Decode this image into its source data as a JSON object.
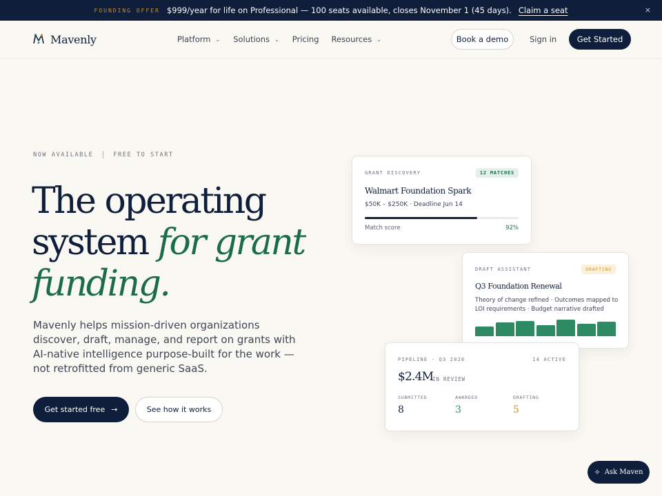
{
  "announcement": {
    "tag": "FOUNDING OFFER",
    "message": "$999/year for life on Professional — 100 seats available, closes November 1 (45 days).",
    "cta": "Claim a seat",
    "close": "×"
  },
  "nav": {
    "brand": "Mavenly",
    "menu": [
      {
        "label": "Platform",
        "has_dropdown": true
      },
      {
        "label": "Solutions",
        "has_dropdown": true
      },
      {
        "label": "Pricing",
        "has_dropdown": false
      },
      {
        "label": "Resources",
        "has_dropdown": true
      }
    ],
    "book_demo": "Book a demo",
    "sign_in": "Sign in",
    "get_started": "Get Started"
  },
  "hero": {
    "eyebrow_left": "NOW AVAILABLE",
    "eyebrow_right": "FREE TO START",
    "headline_line1": "The operating",
    "headline_line2_plain": "system ",
    "headline_line2_accent": "for grant",
    "headline_line3_accent": "funding.",
    "subheadline": "Mavenly helps mission-driven organizations discover, draft, manage, and report on grants with AI-native intelligence purpose-built for the work — not retrofitted from generic SaaS.",
    "primary_cta": "Get started free",
    "primary_cta_icon": "arrow-right-icon",
    "secondary_cta": "See how it works"
  },
  "cards": {
    "discovery": {
      "label": "GRANT DISCOVERY",
      "badge": "12 MATCHES",
      "title": "Walmart Foundation Spark",
      "meta": "$50K – $250K · Deadline Jun 14",
      "match_label": "Match score",
      "match_value": "92%",
      "match_fraction": 0.73
    },
    "draft": {
      "label": "DRAFT ASSISTANT",
      "badge": "DRAFTING",
      "title": "Q3 Foundation Renewal",
      "description": "Theory of change refined · Outcomes mapped to LOI requirements · Budget narrative drafted",
      "bar_levels": [
        0.55,
        0.8,
        0.88,
        0.65,
        0.95,
        0.72,
        0.85
      ]
    },
    "pipeline": {
      "label": "PIPELINE · Q3 2026",
      "active": "14 ACTIVE",
      "amount": "$2.4M",
      "amount_label": "IN REVIEW",
      "stats": [
        {
          "label": "SUBMITTED",
          "value": "8",
          "color": "#0f1e3a"
        },
        {
          "label": "AWARDED",
          "value": "3",
          "color": "#2e8a62"
        },
        {
          "label": "DRAFTING",
          "value": "5",
          "color": "#c9922e"
        }
      ]
    }
  },
  "assistant": {
    "label": "Ask Maven",
    "icon": "sparkle-icon"
  },
  "colors": {
    "navy": "#0f1e3a",
    "green": "#1c6b4a",
    "amber": "#c9922e",
    "background": "#faf8f3"
  }
}
